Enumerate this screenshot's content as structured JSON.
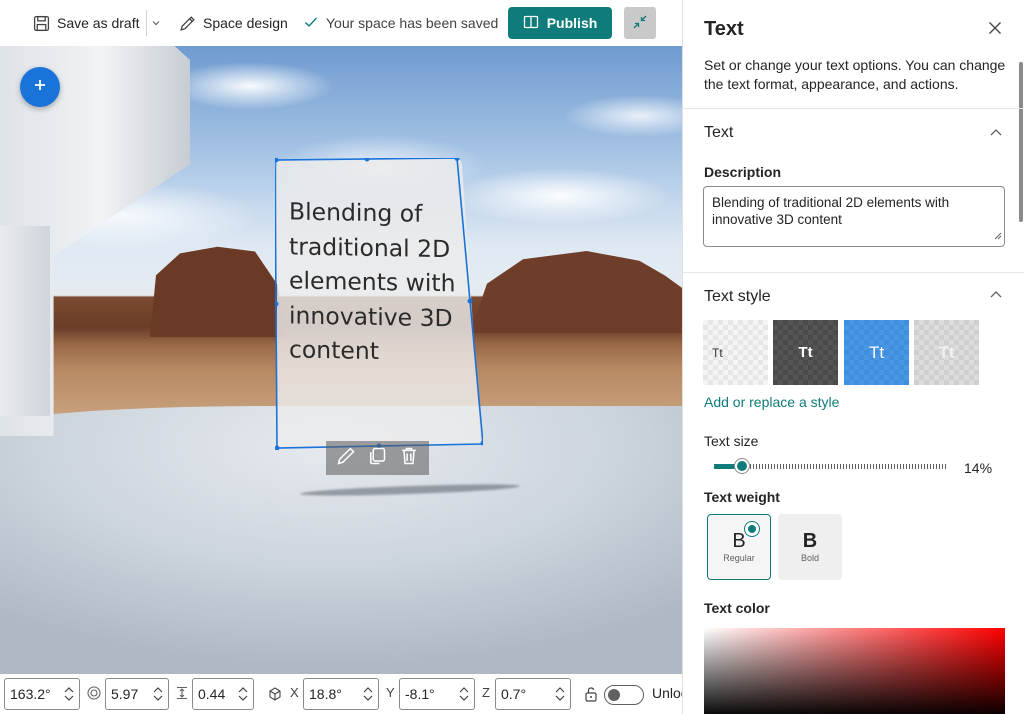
{
  "toolbar": {
    "save_draft_label": "Save as draft",
    "space_design_label": "Space design",
    "saved_message": "Your space has been saved",
    "publish_label": "Publish"
  },
  "scene": {
    "text_object_text": "Blending of traditional 2D elements with innovative 3D content"
  },
  "transform_bar": {
    "rotation": "163.2°",
    "scale": "5.97",
    "height": "0.44",
    "x_label": "X",
    "x_value": "18.8°",
    "y_label": "Y",
    "y_value": "-8.1°",
    "z_label": "Z",
    "z_value": "0.7°",
    "lock_label": "Unlock"
  },
  "panel": {
    "title": "Text",
    "description": "Set or change your text options. You can change the text format, appearance, and actions.",
    "section_text": "Text",
    "description_label": "Description",
    "description_value": "Blending of traditional 2D elements with innovative 3D content",
    "section_style": "Text style",
    "style_tiles": [
      "Tt",
      "Tt",
      "Tt",
      "Tt"
    ],
    "add_style_link": "Add or replace a style",
    "text_size_label": "Text size",
    "text_size_value": "14%",
    "text_size_fraction": 0.12,
    "text_weight_label": "Text weight",
    "weight_regular_big": "B",
    "weight_regular_small": "Regular",
    "weight_bold_big": "B",
    "weight_bold_small": "Bold",
    "text_color_label": "Text color"
  },
  "colors": {
    "accent": "#0f7b7b",
    "add_button": "#1a73d9",
    "selection": "#1a73d9"
  }
}
